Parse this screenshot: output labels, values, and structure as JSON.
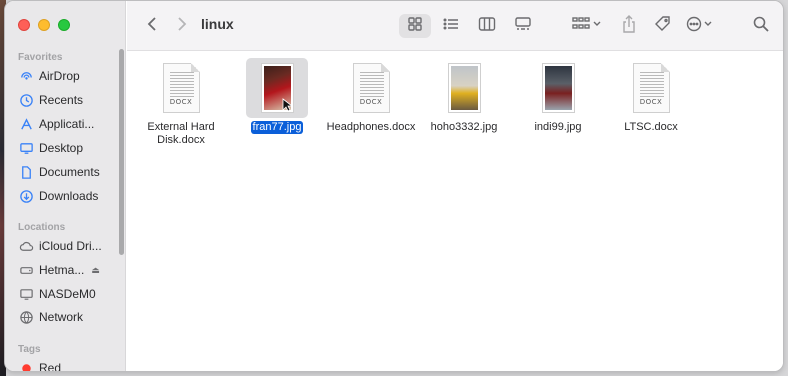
{
  "window": {
    "title": "linux"
  },
  "sidebar": {
    "favorites_label": "Favorites",
    "favorites": [
      {
        "label": "AirDrop",
        "icon": "airdrop-icon"
      },
      {
        "label": "Recents",
        "icon": "clock-icon"
      },
      {
        "label": "Applicati...",
        "icon": "applications-icon"
      },
      {
        "label": "Desktop",
        "icon": "desktop-icon"
      },
      {
        "label": "Documents",
        "icon": "document-icon"
      },
      {
        "label": "Downloads",
        "icon": "download-icon"
      }
    ],
    "locations_label": "Locations",
    "locations": [
      {
        "label": "iCloud Dri...",
        "icon": "cloud-icon"
      },
      {
        "label": "Hetma...",
        "icon": "drive-icon",
        "eject": "⏏"
      },
      {
        "label": "NASDeM0",
        "icon": "monitor-icon"
      },
      {
        "label": "Network",
        "icon": "globe-icon"
      }
    ],
    "tags_label": "Tags",
    "tags": [
      {
        "label": "Red",
        "color": "#ff3b30"
      }
    ]
  },
  "toolbar": {
    "back": "chevron-left-icon",
    "forward": "chevron-right-icon",
    "views": [
      "icon-view-icon",
      "list-view-icon",
      "column-view-icon",
      "gallery-view-icon"
    ],
    "group": "group-icon",
    "share": "share-icon",
    "tag": "tag-icon",
    "more": "ellipsis-icon",
    "search": "search-icon"
  },
  "files": [
    {
      "name_line1": "External Hard",
      "name_line2": "Disk.docx",
      "kind": "docx",
      "ext": "DOCX"
    },
    {
      "name_line1": "fran77.jpg",
      "name_line2": "",
      "kind": "jpg",
      "selected": true,
      "colors": [
        "#3b1f1a",
        "#b3161c",
        "#d8c8b0"
      ]
    },
    {
      "name_line1": "Headphones.docx",
      "name_line2": "",
      "kind": "docx",
      "ext": "DOCX"
    },
    {
      "name_line1": "hoho3332.jpg",
      "name_line2": "",
      "kind": "jpg",
      "colors": [
        "#bfc4c9",
        "#e0b020",
        "#6a5a40"
      ]
    },
    {
      "name_line1": "indi99.jpg",
      "name_line2": "",
      "kind": "jpg",
      "colors": [
        "#2e3540",
        "#7a2020",
        "#9aa4ad"
      ]
    },
    {
      "name_line1": "LTSC.docx",
      "name_line2": "",
      "kind": "docx",
      "ext": "DOCX"
    }
  ]
}
